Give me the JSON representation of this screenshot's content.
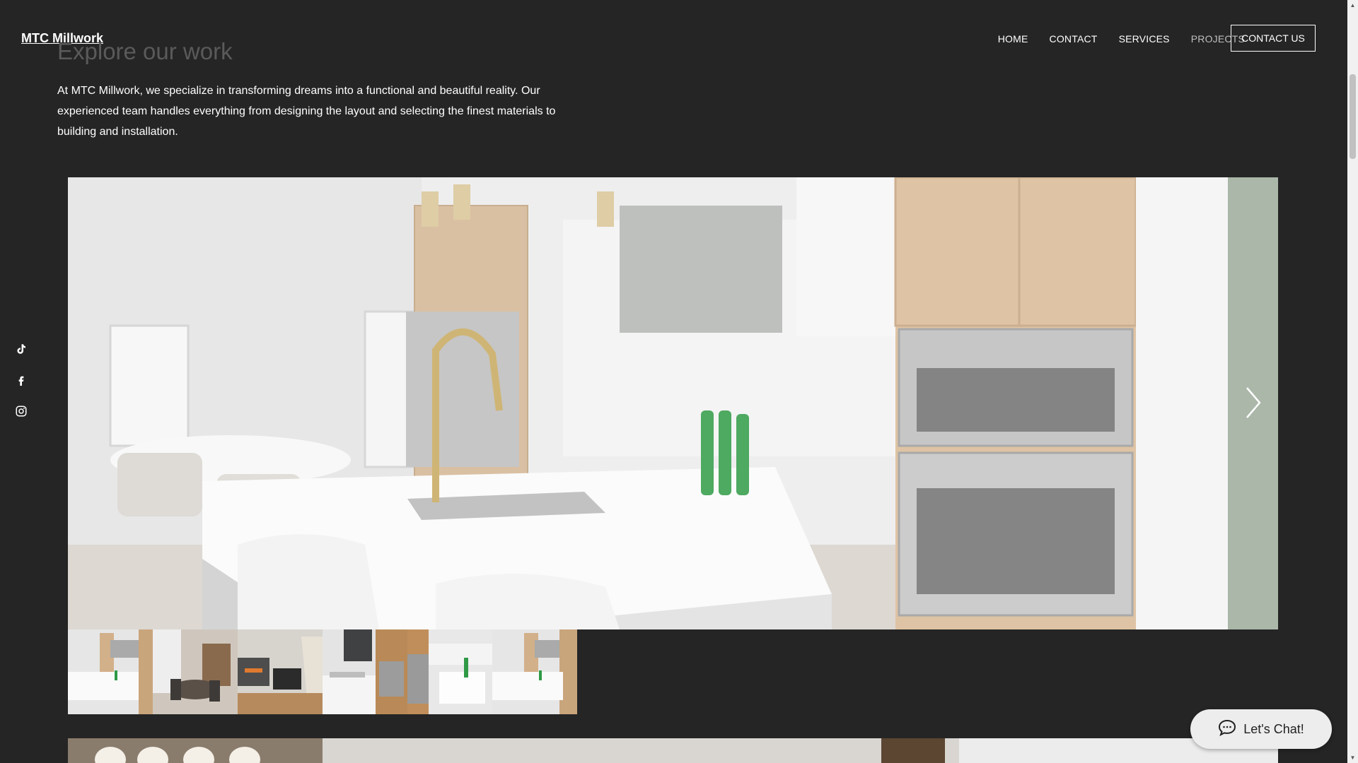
{
  "site": {
    "logo": "MTC Millwork"
  },
  "nav": {
    "items": [
      {
        "label": "HOME"
      },
      {
        "label": "CONTACT"
      },
      {
        "label": "SERVICES"
      },
      {
        "label": "PROJECTS",
        "active": true
      }
    ],
    "cta_label": "CONTACT US"
  },
  "page": {
    "heading": "Explore our work",
    "intro": "At MTC Millwork, we specialize in transforming dreams into a functional and beautiful reality. Our experienced team handles everything from designing the layout and selecting the finest materials to building and installation."
  },
  "social": {
    "icons": [
      "tiktok-icon",
      "facebook-icon",
      "instagram-icon"
    ]
  },
  "gallery": {
    "thumbnail_count": 6,
    "selected_index": 0
  },
  "chat": {
    "label": "Let's Chat!"
  },
  "colors": {
    "background": "#252525",
    "heading": "#5a5a5a",
    "nav_active": "#bdbdbd",
    "chat_bg": "#ededed"
  }
}
